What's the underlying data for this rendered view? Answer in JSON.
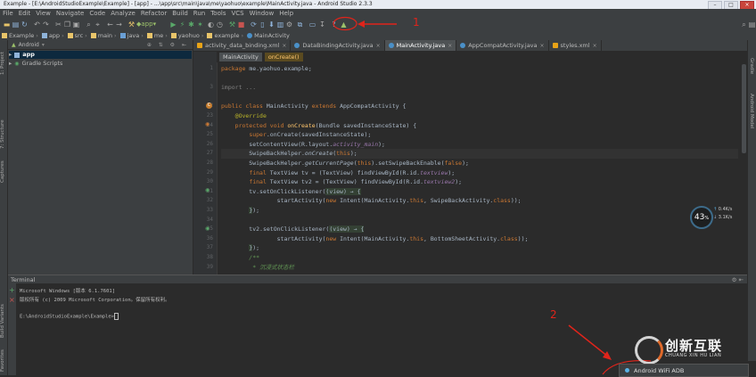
{
  "window": {
    "title": "Example - [E:\\AndroidStudioExample\\Example] - [app] - ...\\app\\src\\main\\java\\me\\yaohuo\\example\\MainActivity.java - Android Studio 2.3.3"
  },
  "menu": [
    "File",
    "Edit",
    "View",
    "Navigate",
    "Code",
    "Analyze",
    "Refactor",
    "Build",
    "Run",
    "Tools",
    "VCS",
    "Window",
    "Help"
  ],
  "toolbar": {
    "run_config": "app"
  },
  "breadcrumbs": [
    "Example",
    "app",
    "src",
    "main",
    "java",
    "me",
    "yaohuo",
    "example",
    "MainActivity"
  ],
  "project": {
    "view_label": "Android",
    "items": [
      "app",
      "Gradle Scripts"
    ]
  },
  "left_tabs": [
    "1: Project",
    "7: Structure",
    "Captures",
    "Build Variants",
    "Favorites"
  ],
  "right_tabs": [
    "Gradle",
    "Android Model"
  ],
  "tabs": [
    {
      "label": "activity_data_binding.xml",
      "color": "#e8a317"
    },
    {
      "label": "DataBindingActivity.java",
      "color": "#4a90c8"
    },
    {
      "label": "MainActivity.java",
      "color": "#4a90c8",
      "active": true
    },
    {
      "label": "AppCompatActivity.java",
      "color": "#4a90c8"
    },
    {
      "label": "styles.xml",
      "color": "#e8a317"
    }
  ],
  "editor_crumbs": [
    "MainActivity",
    "onCreate()"
  ],
  "code": {
    "line_numbers": [
      "1",
      "2",
      "3",
      "",
      "22",
      "23",
      "24",
      "25",
      "26",
      "27",
      "28",
      "29",
      "30",
      "31",
      "32",
      "33",
      "34",
      "35",
      "36",
      "37",
      "38",
      "39",
      "40",
      "41",
      "42",
      "43",
      "44"
    ],
    "lines": [
      "package me.yaohuo.example;",
      "",
      "import ...",
      "",
      "public class MainActivity extends AppCompatActivity {",
      "    @Override",
      "    protected void onCreate(Bundle savedInstanceState) {",
      "        super.onCreate(savedInstanceState);",
      "        setContentView(R.layout.activity_main);",
      "        SwipeBackHelper.onCreate(this);",
      "        SwipeBackHelper.getCurrentPage(this).setSwipeBackEnable(false);",
      "        final TextView tv = (TextView) findViewById(R.id.textview);",
      "        final TextView tv2 = (TextView) findViewById(R.id.textview2);",
      "        tv.setOnClickListener((view) → {",
      "                startActivity(new Intent(MainActivity.this, SwipeBackActivity.class));",
      "        });",
      "",
      "",
      "        tv2.setOnClickListener((view) → {",
      "                startActivity(new Intent(MainActivity.this, BottomSheetActivity.class));",
      "        });",
      "        /**",
      "         * 沉浸式状态栏"
    ]
  },
  "terminal": {
    "title": "Terminal",
    "lines": [
      "Microsoft Windows [版本 6.1.7601]",
      "版权所有 (c) 2009 Microsoft Corporation。保留所有权利。",
      "",
      "E:\\AndroidStudioExample\\Example>"
    ]
  },
  "annotations": {
    "one": "1",
    "two": "2"
  },
  "gauge": {
    "value": "43",
    "unit": "%",
    "up": "0.4K/s",
    "down": "3.1K/s"
  },
  "notification": {
    "label": "Android WiFi ADB"
  },
  "watermark": {
    "name": "创新互联",
    "sub": "CHUANG XIN HU LIAN"
  },
  "colors": {
    "accent_red": "#e0241b",
    "editor_bg": "#2b2b2b",
    "panel_bg": "#3c3f41"
  }
}
